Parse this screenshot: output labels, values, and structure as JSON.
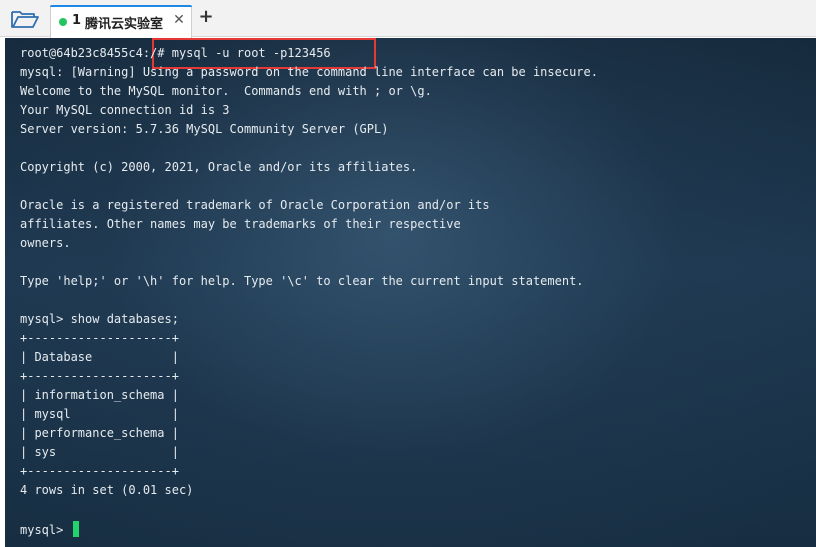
{
  "tabbar": {
    "folder_icon": "folder-open-icon",
    "tab": {
      "number": "1",
      "title": "腾讯云实验室",
      "status_color": "#22c55e",
      "close_label": "✕"
    },
    "add_label": "+"
  },
  "terminal": {
    "lines": [
      "root@64b23c8455c4:/# mysql -u root -p123456",
      "mysql: [Warning] Using a password on the command line interface can be insecure.",
      "Welcome to the MySQL monitor.  Commands end with ; or \\g.",
      "Your MySQL connection id is 3",
      "Server version: 5.7.36 MySQL Community Server (GPL)",
      "",
      "Copyright (c) 2000, 2021, Oracle and/or its affiliates.",
      "",
      "Oracle is a registered trademark of Oracle Corporation and/or its",
      "affiliates. Other names may be trademarks of their respective",
      "owners.",
      "",
      "Type 'help;' or '\\h' for help. Type '\\c' to clear the current input statement.",
      "",
      "mysql> show databases;",
      "+--------------------+",
      "| Database           |",
      "+--------------------+",
      "| information_schema |",
      "| mysql              |",
      "| performance_schema |",
      "| sys                |",
      "+--------------------+",
      "4 rows in set (0.01 sec)",
      ""
    ],
    "prompt": "mysql> ",
    "cursor_color": "#22d36b",
    "highlight_color": "#e53935"
  }
}
